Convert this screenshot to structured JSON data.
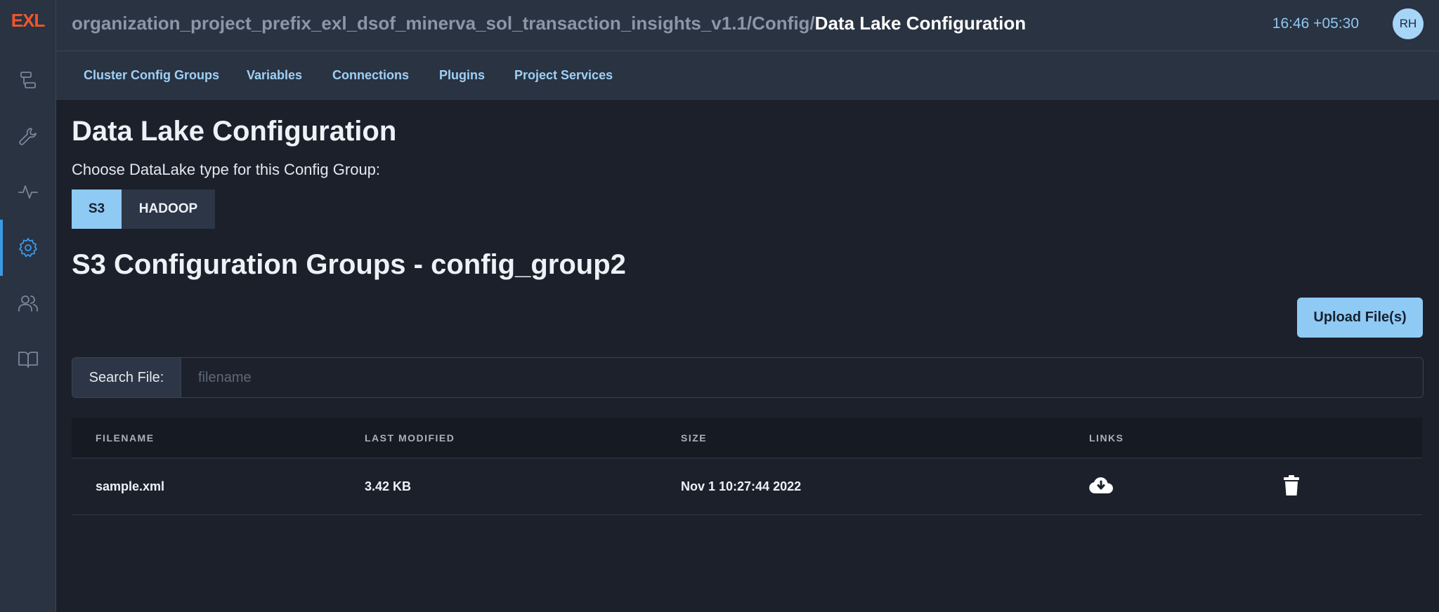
{
  "app": {
    "logo": "EXL"
  },
  "sidebar": {
    "items": [
      {
        "name": "pipelines"
      },
      {
        "name": "tools"
      },
      {
        "name": "monitoring"
      },
      {
        "name": "settings",
        "active": true
      },
      {
        "name": "users"
      },
      {
        "name": "docs"
      }
    ]
  },
  "header": {
    "breadcrumb_path": "organization_project_prefix_exl_dsof_minerva_sol_transaction_insights_v1.1/Config/",
    "breadcrumb_current": "Data Lake Configuration",
    "time": "16:46 +05:30",
    "avatar_initials": "RH"
  },
  "subnav": {
    "items": [
      "Cluster Config Groups",
      "Variables",
      "Connections",
      "Plugins",
      "Project Services"
    ]
  },
  "main": {
    "title": "Data Lake Configuration",
    "choose_label": "Choose DataLake type for this Config Group:",
    "types": [
      "S3",
      "HADOOP"
    ],
    "selected_type": "S3",
    "section_title": "S3 Configuration Groups - config_group2",
    "upload_label": "Upload File(s)",
    "search_label": "Search File:",
    "search_placeholder": "filename",
    "search_value": ""
  },
  "table": {
    "headers": [
      "FILENAME",
      "LAST MODIFIED",
      "SIZE",
      "LINKS"
    ],
    "rows": [
      {
        "filename": "sample.xml",
        "last_modified": "3.42 KB",
        "size": "Nov 1 10:27:44 2022"
      }
    ]
  },
  "colors": {
    "accent": "#3b9ae8",
    "primary_button": "#8fcaf4",
    "logo": "#f0562c",
    "background": "#1b202b",
    "panel": "#2a3342"
  }
}
